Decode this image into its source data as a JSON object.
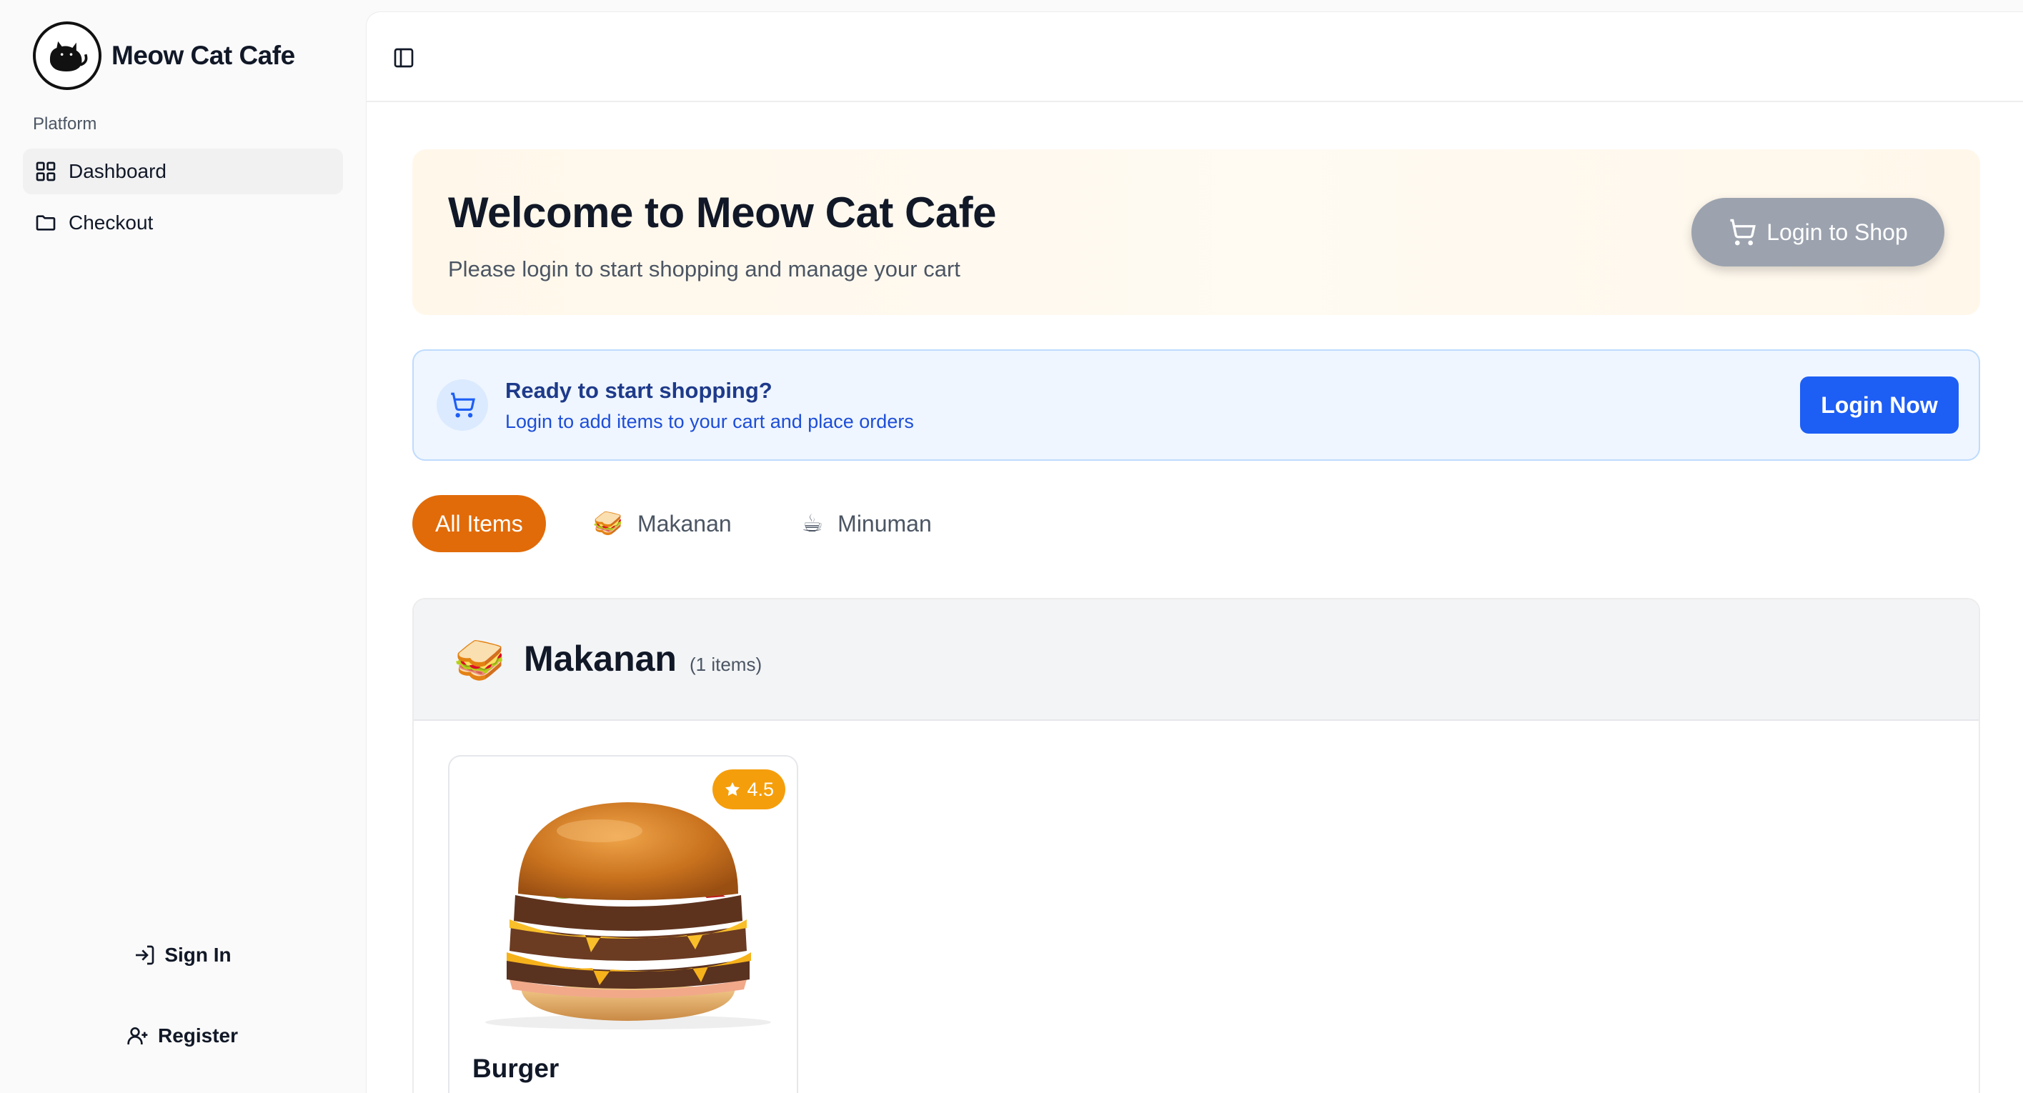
{
  "sidebar": {
    "brand_name": "Meow Cat Cafe",
    "logo_text": "Meow Cat Cafe",
    "group_label": "Platform",
    "items": [
      {
        "label": "Dashboard",
        "icon": "grid-icon",
        "active": true
      },
      {
        "label": "Checkout",
        "icon": "folder-icon",
        "active": false
      }
    ],
    "sign_in_label": "Sign In",
    "register_label": "Register"
  },
  "hero": {
    "title": "Welcome to Meow Cat Cafe",
    "subtitle": "Please login to start shopping and manage your cart",
    "button_label": "Login to Shop"
  },
  "notice": {
    "title": "Ready to start shopping?",
    "subtitle": "Login to add items to your cart and place orders",
    "button_label": "Login Now"
  },
  "tabs": [
    {
      "label": "All Items",
      "emoji": "",
      "active": true
    },
    {
      "label": "Makanan",
      "emoji": "🥪",
      "active": false
    },
    {
      "label": "Minuman",
      "emoji": "☕",
      "active": false
    }
  ],
  "section": {
    "emoji": "🥪",
    "title": "Makanan",
    "count": "(1 items)"
  },
  "products": [
    {
      "name": "Burger",
      "rating": "4.5"
    }
  ],
  "colors": {
    "accent_orange": "#e16b09",
    "primary_blue": "#1d5ef5",
    "rating_amber": "#f59e0b",
    "disabled_gray": "#9ca3af"
  }
}
